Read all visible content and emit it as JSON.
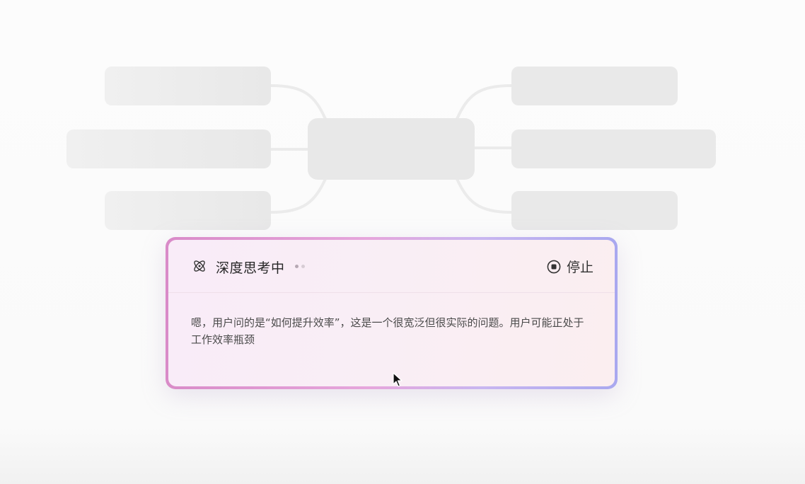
{
  "thinking_panel": {
    "status_label": "深度思考中",
    "stop_label": "停止",
    "content": "嗯，用户问的是“如何提升效率”，这是一个很宽泛但很实际的问题。用户可能正处于工作效率瓶颈"
  },
  "icons": {
    "status": "atom-icon",
    "stop": "stop-circle-icon",
    "cursor": "mouse-pointer-icon"
  },
  "colors": {
    "card_border_start": "#d98bc8",
    "card_border_end": "#a9a8ef",
    "placeholder_node": "#e9e9e9",
    "connector_line": "#ececec"
  }
}
